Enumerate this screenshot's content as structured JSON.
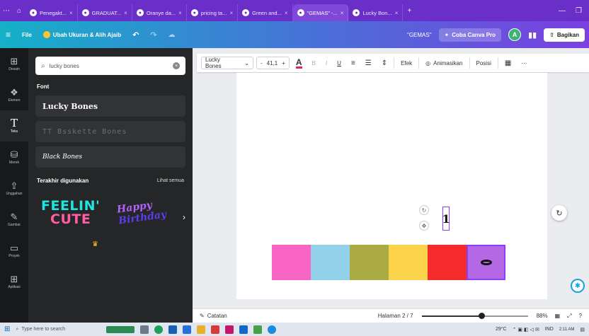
{
  "browser": {
    "tabs": [
      {
        "label": "Penegakt...",
        "active": false
      },
      {
        "label": "GRADUAT...",
        "active": false
      },
      {
        "label": "Oranye da...",
        "active": false
      },
      {
        "label": "pricing ta...",
        "active": false
      },
      {
        "label": "Green and...",
        "active": false
      },
      {
        "label": "\"GEMAS\" -...",
        "active": true
      },
      {
        "label": "Lucky Bon...",
        "active": false
      }
    ],
    "new_tab": "+"
  },
  "menubar": {
    "file": "File",
    "resize": "Ubah Ukuran & Alih Ajaib",
    "doc_title": "\"GEMAS\"",
    "pro": "Coba Canva Pro",
    "avatar": "A",
    "share": "Bagikan"
  },
  "rail": [
    {
      "icon": "⊞",
      "label": "Desain"
    },
    {
      "icon": "❖",
      "label": "Elemen"
    },
    {
      "icon": "T",
      "label": "Teks"
    },
    {
      "icon": "⛁",
      "label": "Merek"
    },
    {
      "icon": "⇪",
      "label": "Unggahan"
    },
    {
      "icon": "✎",
      "label": "Gambar"
    },
    {
      "icon": "▭",
      "label": "Proyek"
    },
    {
      "icon": "⊞",
      "label": "Aplikasi"
    }
  ],
  "panel": {
    "search_value": "lucky bones",
    "font_title": "Font",
    "fonts": [
      "Lucky Bones",
      "TT Bsskette Bones",
      "Black Bones"
    ],
    "recent_title": "Terakhir digunakan",
    "see_all": "Lihat semua",
    "recent_1_line1": "FEELIN'",
    "recent_1_line2": "CUTE",
    "recent_2_line1": "Happy",
    "recent_2_line2": "Birthday"
  },
  "toolbar": {
    "font": "Lucky Bones",
    "minus": "-",
    "size": "41,1",
    "plus": "+",
    "color_letter": "A",
    "bold": "B",
    "italic": "I",
    "underline": "U",
    "effects": "Efek",
    "animate": "Animasikan",
    "position": "Posisi"
  },
  "canvas": {
    "swatches": [
      "#f864c4",
      "#92d1ea",
      "#abab44",
      "#fcd44c",
      "#f52b2b",
      "#b468e4"
    ],
    "selected_text": "1"
  },
  "statusbar": {
    "notes": "Catatan",
    "page": "Halaman 2 / 7",
    "zoom_fraction": 0.56,
    "zoom": "88%"
  },
  "taskbar": {
    "search_placeholder": "Type here to search",
    "weather": "29°C",
    "lang": "IND",
    "time": "2:11 AM"
  }
}
